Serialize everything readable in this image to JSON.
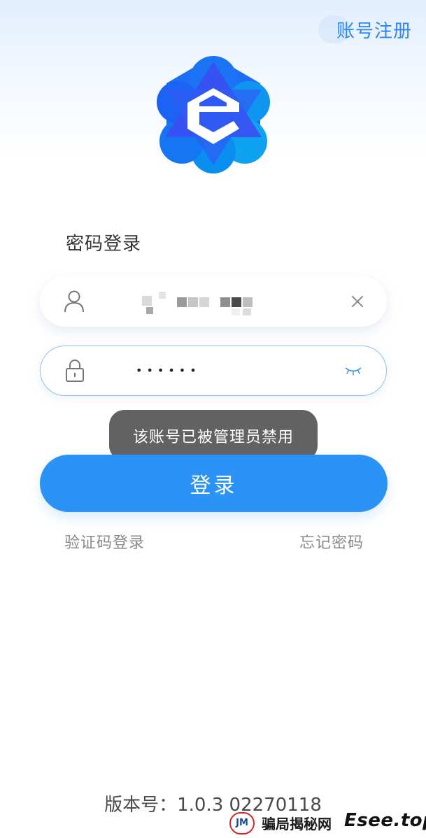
{
  "header": {
    "register_label": "账号注册"
  },
  "logo": {
    "icon": "app-logo-e",
    "colors": [
      "#1e6df5",
      "#0fa2f0",
      "#3b4ff2"
    ]
  },
  "login": {
    "title": "密码登录",
    "username": {
      "icon": "user-icon",
      "value_masked": true,
      "clear_icon": "close-icon"
    },
    "password": {
      "icon": "lock-icon",
      "value": "••••••",
      "toggle_icon": "eye-closed-icon"
    },
    "button_label": "登录",
    "sms_login_label": "验证码登录",
    "forgot_password_label": "忘记密码"
  },
  "toast": {
    "message": "该账号已被管理员禁用"
  },
  "footer": {
    "version": "版本号：1.0.3 02270118"
  },
  "watermark": {
    "logo_text": "JM",
    "site_name": "骗局揭秘网",
    "domain": "Esee.top"
  },
  "colors": {
    "accent": "#2b93f6",
    "toast_bg": "#464646",
    "link_gray": "#8a8a8a"
  }
}
